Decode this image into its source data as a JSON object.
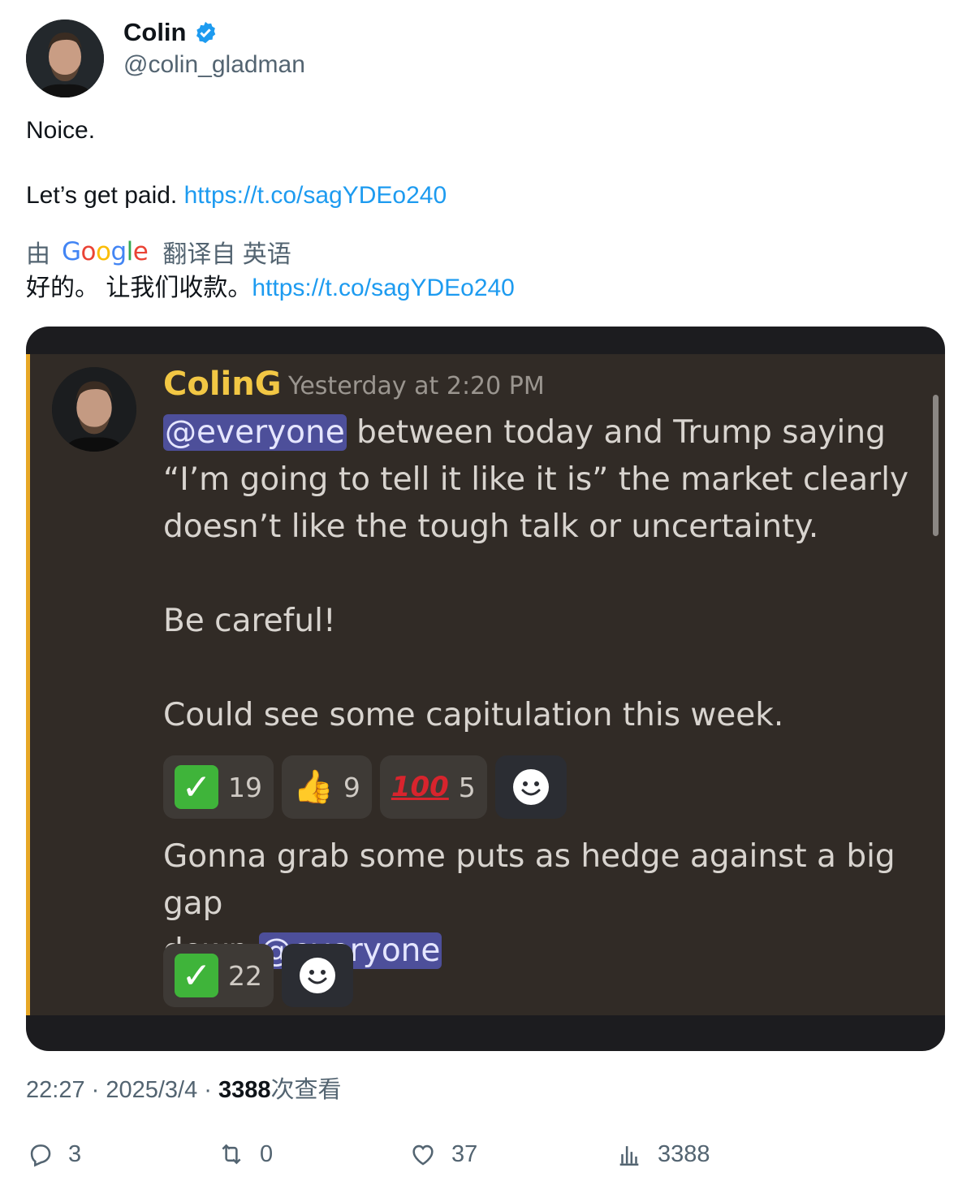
{
  "author": {
    "name": "Colin",
    "handle": "@colin_gladman"
  },
  "tweet": {
    "line1": "Noice.",
    "line2_text": "Let’s get paid.",
    "link": "https://t.co/sagYDEo240"
  },
  "translation": {
    "prefix": "由",
    "google_letters": [
      "G",
      "o",
      "o",
      "g",
      "l",
      "e"
    ],
    "suffix": "翻译自 英语",
    "text": "好的。 让我们收款。",
    "link": "https://t.co/sagYDEo240"
  },
  "discord": {
    "username": "ColinG",
    "timestamp": "Yesterday at 2:20 PM",
    "mention": "@everyone",
    "message1_rest": " between today and Trump saying\n“I’m going to tell it like it is” the market clearly\ndoesn’t like the tough talk or uncertainty.\n\nBe careful!\n\nCould see some capitulation this week.",
    "reactions1": [
      {
        "emoji": "check-mark-icon",
        "count": "19"
      },
      {
        "emoji": "thumbs-up-icon",
        "glyph": "👍",
        "count": "9"
      },
      {
        "emoji": "hundred-icon",
        "glyph": "100",
        "count": "5"
      }
    ],
    "message2_text": "Gonna grab some puts as hedge against a big gap\ndown ",
    "message2_mention": "@everyone",
    "reactions2": [
      {
        "emoji": "check-mark-icon",
        "count": "22"
      }
    ],
    "colors": {
      "accent": "#e7a726",
      "username": "#f2c744",
      "mention_bg": "#4d4f9a"
    }
  },
  "meta": {
    "time": "22:27",
    "date": "2025/3/4",
    "views_count": "3388",
    "views_label": "次查看"
  },
  "actions": {
    "replies": "3",
    "reposts": "0",
    "likes": "37",
    "views": "3388"
  }
}
